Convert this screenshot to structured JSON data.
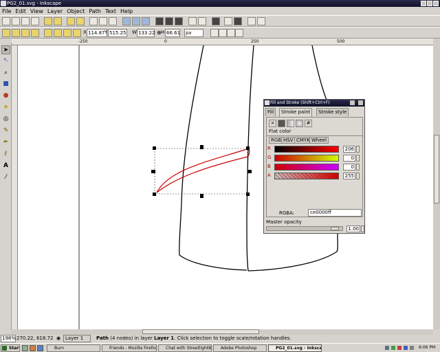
{
  "window": {
    "title": "PG2_01.svg - Inkscape"
  },
  "menu": [
    "File",
    "Edit",
    "View",
    "Layer",
    "Object",
    "Path",
    "Text",
    "Help"
  ],
  "tool_controls": {
    "x_label": "X",
    "x_value": "114.87",
    "y_label": "Y",
    "y_value": "515.25",
    "w_label": "W",
    "w_value": "133.22",
    "h_label": "H",
    "h_value": "66.61",
    "unit": "px"
  },
  "ruler_ticks": [
    "-250",
    "0",
    "250",
    "500"
  ],
  "dialog": {
    "title": "Fill and Stroke (Shift+Ctrl+F)",
    "tabs": [
      "Fill",
      "Stroke paint",
      "Stroke style"
    ],
    "active_tab": "Stroke paint",
    "paint_mode_label": "Flat color",
    "color_tabs": [
      "RGB",
      "HSV",
      "CMYK",
      "Wheel"
    ],
    "channels": [
      {
        "label": "R",
        "value": "206"
      },
      {
        "label": "G",
        "value": "0"
      },
      {
        "label": "B",
        "value": "0"
      },
      {
        "label": "A",
        "value": "255"
      }
    ],
    "rgba_label": "RGBA:",
    "rgba_value": "ce0000ff",
    "master_opacity_label": "Master opacity",
    "master_opacity_value": "1.00",
    "master_opacity_fraction": 0.95
  },
  "status": {
    "zoom": "198%",
    "coords": "270.22, 618.72",
    "layer": "Layer 1",
    "message_strong": "Path",
    "message": " (4 nodes) in layer ",
    "message_layer": "Layer 1",
    "message_end": ". Click selection to toggle scale/rotation handles."
  },
  "taskbar": {
    "start": "Start",
    "tasks": [
      "Burn",
      "Friends - Mozilla Firefox",
      "Chat with StreetlightBat...",
      "Adobe Photoshop",
      "PG2_01.svg - Inkscape"
    ],
    "active_task": "PG2_01.svg - Inkscape",
    "clock": "6:06 PM"
  },
  "colors": {
    "stroke": "#ce0000",
    "titlebar": "#1a1a3a"
  }
}
